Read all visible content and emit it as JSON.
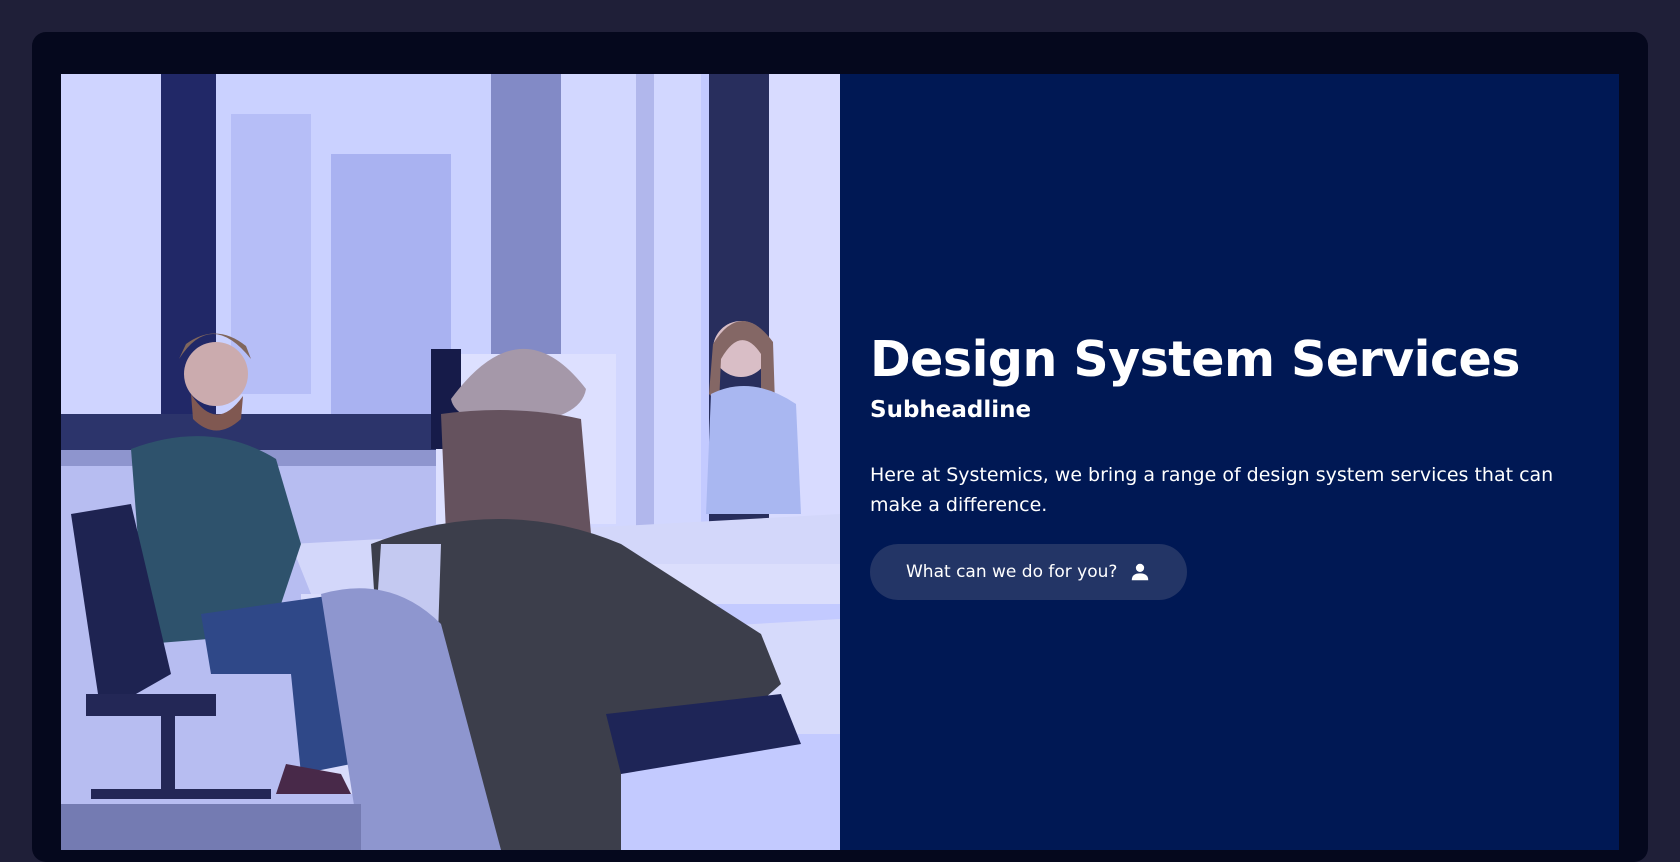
{
  "hero": {
    "headline": "Design System Services",
    "subheadline": "Subheadline",
    "body": "Here at Systemics, we bring a range of design system services that can make a difference.",
    "cta": {
      "label": "What can we do for you?",
      "icon": "user-icon"
    },
    "image": {
      "description_icon": "office-team-photo",
      "tint": "#3b4cff"
    }
  },
  "colors": {
    "page_background": "#1f1f38",
    "frame": "#05081d",
    "content_background": "#001854",
    "button_background": "#233566",
    "text": "#ffffff"
  }
}
